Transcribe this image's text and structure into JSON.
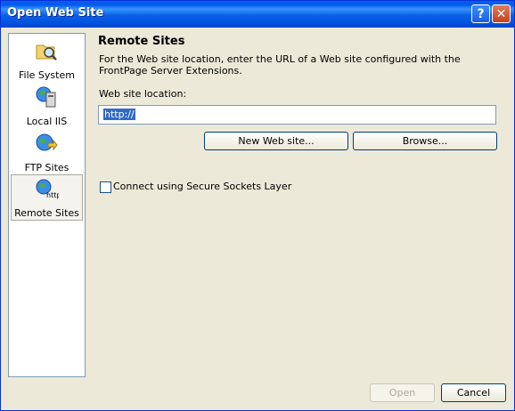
{
  "window": {
    "title": "Open Web Site",
    "help_label": "?",
    "close_label": "✕"
  },
  "sidebar": {
    "items": [
      {
        "label": "File System",
        "icon": "folder-search-icon"
      },
      {
        "label": "Local IIS",
        "icon": "globe-computer-icon"
      },
      {
        "label": "FTP Sites",
        "icon": "globe-arrows-icon"
      },
      {
        "label": "Remote Sites",
        "icon": "globe-http-icon",
        "selected": true,
        "badge": "http:"
      }
    ]
  },
  "main": {
    "heading": "Remote Sites",
    "description": "For the Web site location, enter the URL of a Web site configured with the FrontPage Server Extensions.",
    "location_label": "Web site location:",
    "location_value": "http://",
    "new_site_button": "New Web site...",
    "browse_button": "Browse...",
    "ssl_checkbox": {
      "label": "Connect using Secure Sockets Layer",
      "checked": false
    }
  },
  "footer": {
    "open_button": "Open",
    "cancel_button": "Cancel"
  }
}
